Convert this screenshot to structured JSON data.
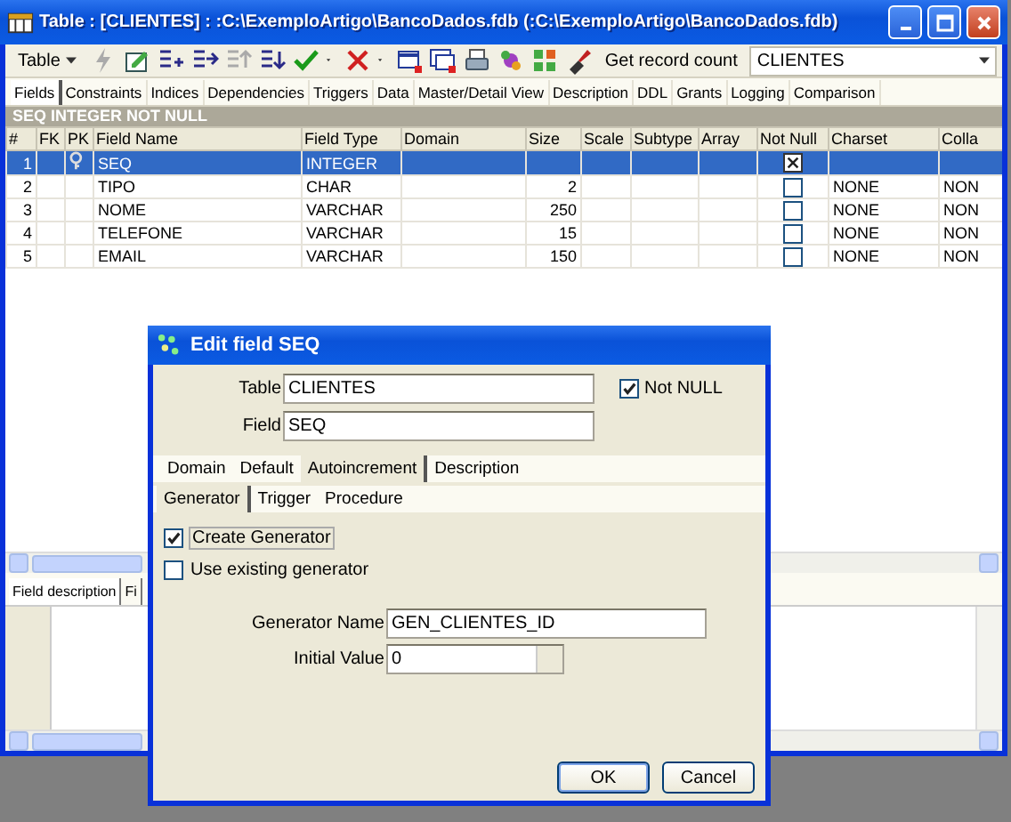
{
  "window": {
    "title": "Table : [CLIENTES] : :C:\\ExemploArtigo\\BancoDados.fdb (:C:\\ExemploArtigo\\BancoDados.fdb)"
  },
  "toolbar": {
    "menu_button": "Table",
    "record_count_button": "Get record count",
    "table_combo": "CLIENTES"
  },
  "tabs": [
    {
      "label": "Fields",
      "selected": true
    },
    {
      "label": "Constraints",
      "selected": false
    },
    {
      "label": "Indices",
      "selected": false
    },
    {
      "label": "Dependencies",
      "selected": false
    },
    {
      "label": "Triggers",
      "selected": false
    },
    {
      "label": "Data",
      "selected": false
    },
    {
      "label": "Master/Detail View",
      "selected": false
    },
    {
      "label": "Description",
      "selected": false
    },
    {
      "label": "DDL",
      "selected": false
    },
    {
      "label": "Grants",
      "selected": false
    },
    {
      "label": "Logging",
      "selected": false
    },
    {
      "label": "Comparison",
      "selected": false
    }
  ],
  "info_bar": "SEQ INTEGER NOT NULL",
  "grid": {
    "columns": [
      "#",
      "FK",
      "PK",
      "Field Name",
      "Field Type",
      "Domain",
      "Size",
      "Scale",
      "Subtype",
      "Array",
      "Not Null",
      "Charset",
      "Colla"
    ],
    "rows": [
      {
        "number": "1",
        "pk": true,
        "field_name": "SEQ",
        "field_type": "INTEGER",
        "not_null": true,
        "selected": true
      },
      {
        "number": "2",
        "pk": false,
        "field_name": "TIPO",
        "field_type": "CHAR",
        "size": "2",
        "not_null": false,
        "charset": "NONE",
        "collation": "NON",
        "selected": false
      },
      {
        "number": "3",
        "pk": false,
        "field_name": "NOME",
        "field_type": "VARCHAR",
        "size": "250",
        "not_null": false,
        "charset": "NONE",
        "collation": "NON",
        "selected": false
      },
      {
        "number": "4",
        "pk": false,
        "field_name": "TELEFONE",
        "field_type": "VARCHAR",
        "size": "15",
        "not_null": false,
        "charset": "NONE",
        "collation": "NON",
        "selected": false
      },
      {
        "number": "5",
        "pk": false,
        "field_name": "EMAIL",
        "field_type": "VARCHAR",
        "size": "150",
        "not_null": false,
        "charset": "NONE",
        "collation": "NON",
        "selected": false
      }
    ]
  },
  "bottom_tabs": [
    {
      "label": "Field description",
      "selected": true
    },
    {
      "label": "Fi",
      "selected": false
    }
  ],
  "dialog": {
    "title": "Edit field SEQ",
    "table_label": "Table",
    "table_value": "CLIENTES",
    "not_null": {
      "label": "Not NULL",
      "checked": true
    },
    "field_label": "Field",
    "field_value": "SEQ",
    "tabs": [
      {
        "label": "Domain",
        "selected": false
      },
      {
        "label": "Default",
        "selected": false
      },
      {
        "label": "Autoincrement",
        "selected": true
      },
      {
        "label": "Description",
        "selected": false
      }
    ],
    "subtabs": [
      {
        "label": "Generator",
        "selected": true
      },
      {
        "label": "Trigger",
        "selected": false
      },
      {
        "label": "Procedure",
        "selected": false
      }
    ],
    "options": [
      {
        "label": "Create Generator",
        "checked": true
      },
      {
        "label": "Use existing generator",
        "checked": false
      }
    ],
    "generator_name_label": "Generator Name",
    "generator_name": "GEN_CLIENTES_ID",
    "initial_value_label": "Initial Value",
    "initial_value": "0",
    "buttons": [
      "OK",
      "Cancel"
    ]
  }
}
